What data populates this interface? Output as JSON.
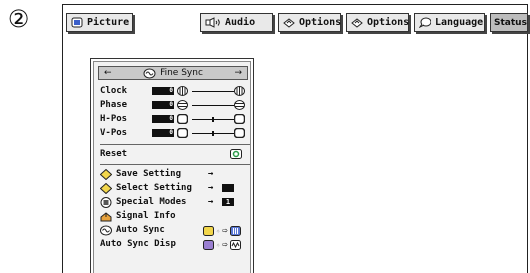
{
  "step_marker": "②",
  "tabs": [
    {
      "label": "Picture",
      "icon": "picture-icon"
    },
    {
      "label": "Audio",
      "icon": "speaker-icon"
    },
    {
      "label": "Options",
      "icon": "options-icon"
    },
    {
      "label": "Options",
      "icon": "options-icon"
    },
    {
      "label": "Language",
      "icon": "speech-bubble-icon"
    },
    {
      "label": "Status",
      "icon": ""
    }
  ],
  "menu": {
    "title": "Fine Sync",
    "adjust_rows": [
      {
        "label": "Clock",
        "value": "0"
      },
      {
        "label": "Phase",
        "value": "0"
      },
      {
        "label": "H-Pos",
        "value": "0"
      },
      {
        "label": "V-Pos",
        "value": "0"
      }
    ],
    "reset_label": "Reset",
    "items": [
      {
        "label": "Save Setting"
      },
      {
        "label": "Select Setting"
      },
      {
        "label": "Special Modes",
        "value": "1"
      },
      {
        "label": "Signal Info"
      },
      {
        "label": "Auto Sync"
      },
      {
        "label": "Auto Sync Disp"
      }
    ]
  },
  "colors": {
    "highlight": "#c9c9c9",
    "panel_bg": "#f2f2f2",
    "icon_yellow": "#f2d64b",
    "icon_blue": "#5a78d6",
    "icon_purple": "#9a7fd1"
  }
}
